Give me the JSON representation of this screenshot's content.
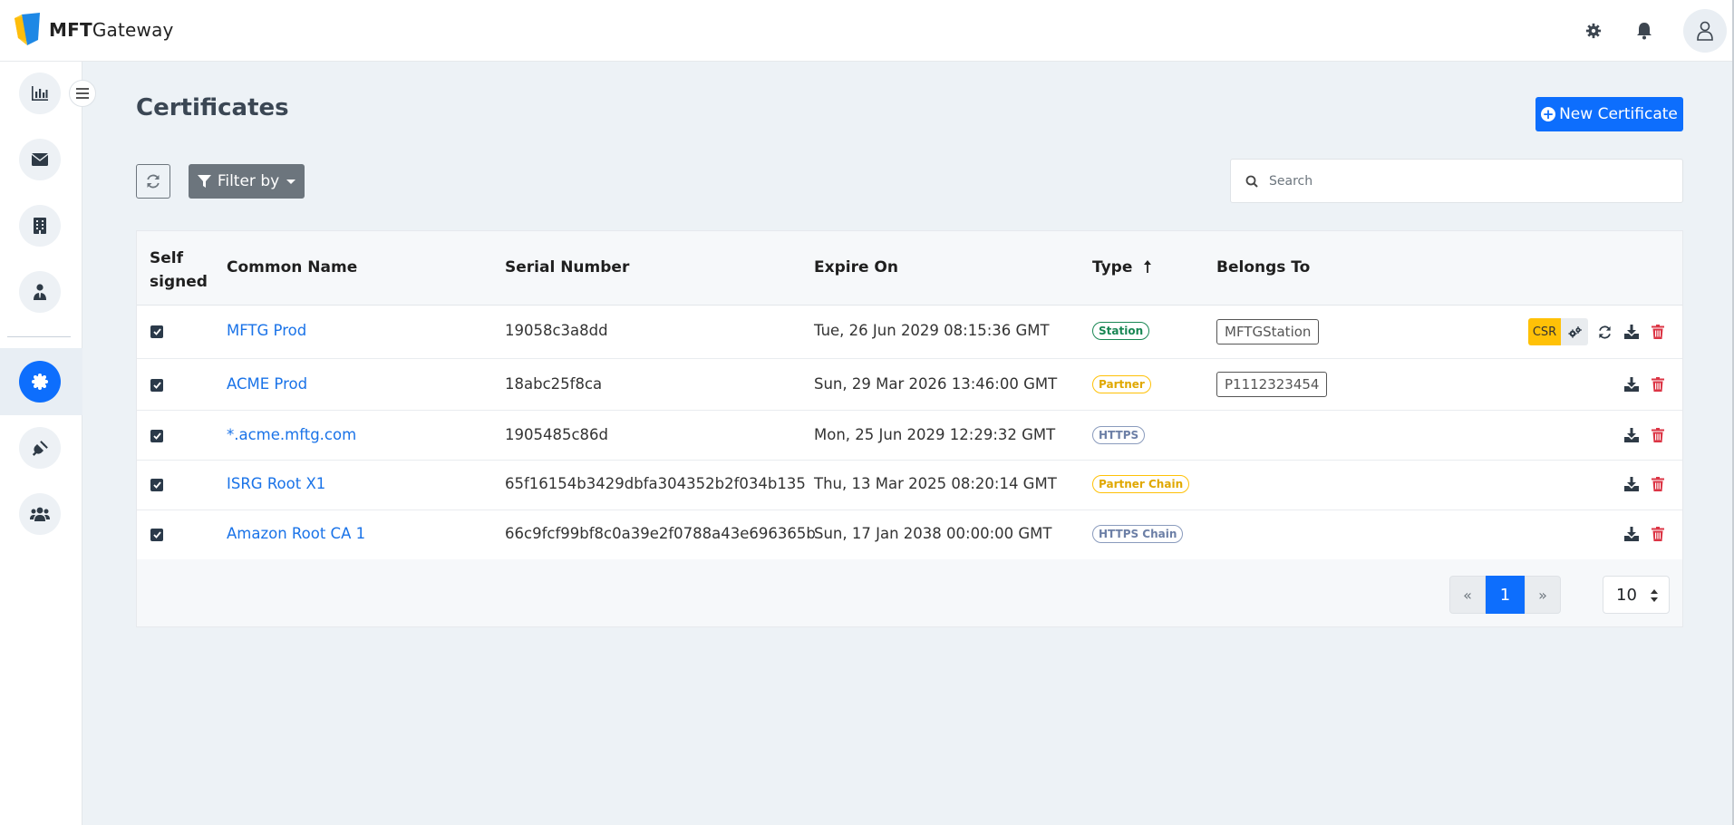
{
  "app": {
    "brand_bold": "MFT",
    "brand_rest": "Gateway"
  },
  "header": {
    "icons": [
      "gear-icon",
      "bell-icon",
      "user-icon"
    ]
  },
  "sidebar": {
    "items": [
      {
        "name": "dashboard",
        "icon": "chart-bar-icon"
      },
      {
        "name": "messages",
        "icon": "envelope-icon"
      },
      {
        "name": "stations",
        "icon": "building-icon"
      },
      {
        "name": "partners",
        "icon": "user-tie-icon"
      },
      {
        "name": "certificates",
        "icon": "certificate-icon",
        "active": true
      },
      {
        "name": "integrations",
        "icon": "plug-icon"
      },
      {
        "name": "users",
        "icon": "users-icon"
      }
    ]
  },
  "page": {
    "title": "Certificates",
    "new_button": "New Certificate",
    "filter_button": "Filter by",
    "search_placeholder": "Search"
  },
  "table": {
    "headers": {
      "self_signed_1": "Self",
      "self_signed_2": "signed",
      "common_name": "Common Name",
      "serial_number": "Serial Number",
      "expire_on": "Expire On",
      "type": "Type",
      "belongs_to": "Belongs To"
    },
    "sort": {
      "column": "type",
      "direction": "ascending"
    },
    "rows": [
      {
        "self_signed": true,
        "common_name": "MFTG Prod",
        "serial": "19058c3a8dd",
        "expire": "Tue, 26 Jun 2029 08:15:36 GMT",
        "type": "Station",
        "belongs_to": "MFTGStation",
        "csr_label": "CSR"
      },
      {
        "self_signed": true,
        "common_name": "ACME Prod",
        "serial": "18abc25f8ca",
        "expire": "Sun, 29 Mar 2026 13:46:00 GMT",
        "type": "Partner",
        "belongs_to": "P1112323454"
      },
      {
        "self_signed": true,
        "common_name": "*.acme.mftg.com",
        "serial": "1905485c86d",
        "expire": "Mon, 25 Jun 2029 12:29:32 GMT",
        "type": "HTTPS",
        "belongs_to": ""
      },
      {
        "self_signed": true,
        "common_name": "ISRG Root X1",
        "serial": "65f16154b3429dbfa304352b2f034b135",
        "expire": "Thu, 13 Mar 2025 08:20:14 GMT",
        "type": "Partner Chain",
        "belongs_to": ""
      },
      {
        "self_signed": true,
        "common_name": "Amazon Root CA 1",
        "serial": "66c9fcf99bf8c0a39e2f0788a43e696365b",
        "expire": "Sun, 17 Jan 2038 00:00:00 GMT",
        "type": "HTTPS Chain",
        "belongs_to": ""
      }
    ]
  },
  "pagination": {
    "prev": "«",
    "current": "1",
    "next": "»",
    "page_size": "10"
  },
  "colors": {
    "primary": "#0d6efd",
    "station": "#198754",
    "partner": "#ffc107",
    "https": "#6c7fa6",
    "danger": "#dc3545",
    "warning": "#ffc107"
  }
}
